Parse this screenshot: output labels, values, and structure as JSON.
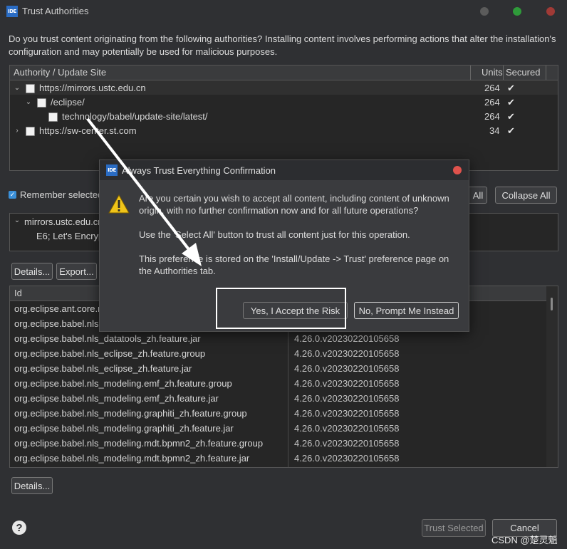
{
  "window": {
    "title": "Trust Authorities",
    "icon_label": "IDE"
  },
  "description": "Do you trust content originating from the following authorities?  Installing content involves performing actions that alter the installation's configuration and may potentially be used for malicious purposes.",
  "authorities_table": {
    "columns": [
      "Authority / Update Site",
      "Units",
      "Secured"
    ],
    "rows": [
      {
        "label": "https://mirrors.ustc.edu.cn",
        "units": "264",
        "indent": 0,
        "chevron": "down"
      },
      {
        "label": "/eclipse/",
        "units": "264",
        "indent": 1,
        "chevron": "down"
      },
      {
        "label": "technology/babel/update-site/latest/",
        "units": "264",
        "indent": 2,
        "chevron": ""
      },
      {
        "label": "https://sw-center.st.com",
        "units": "34",
        "indent": 0,
        "chevron": "right"
      }
    ]
  },
  "remember": {
    "label": "Remember selected"
  },
  "buttons": {
    "select_all_partial": "All",
    "collapse_all": "Collapse All",
    "details": "Details...",
    "export": "Export...",
    "details2": "Details...",
    "trust_selected": "Trust Selected",
    "cancel": "Cancel",
    "help": "?"
  },
  "cert_tree": {
    "item": "mirrors.ustc.edu.cn",
    "child": "E6; Let's Encrypt"
  },
  "units_table": {
    "column_id": "Id",
    "rows": [
      {
        "id": "org.eclipse.ant.core.n",
        "version": ""
      },
      {
        "id": "org.eclipse.babel.nls",
        "version": ""
      },
      {
        "id": "org.eclipse.babel.nls_datatools_zh.feature.jar",
        "version": "4.26.0.v20230220105658"
      },
      {
        "id": "org.eclipse.babel.nls_eclipse_zh.feature.group",
        "version": "4.26.0.v20230220105658"
      },
      {
        "id": "org.eclipse.babel.nls_eclipse_zh.feature.jar",
        "version": "4.26.0.v20230220105658"
      },
      {
        "id": "org.eclipse.babel.nls_modeling.emf_zh.feature.group",
        "version": "4.26.0.v20230220105658"
      },
      {
        "id": "org.eclipse.babel.nls_modeling.emf_zh.feature.jar",
        "version": "4.26.0.v20230220105658"
      },
      {
        "id": "org.eclipse.babel.nls_modeling.graphiti_zh.feature.group",
        "version": "4.26.0.v20230220105658"
      },
      {
        "id": "org.eclipse.babel.nls_modeling.graphiti_zh.feature.jar",
        "version": "4.26.0.v20230220105658"
      },
      {
        "id": "org.eclipse.babel.nls_modeling.mdt.bpmn2_zh.feature.group",
        "version": "4.26.0.v20230220105658"
      },
      {
        "id": "org.eclipse.babel.nls_modeling.mdt.bpmn2_zh.feature.jar",
        "version": "4.26.0.v20230220105658"
      }
    ]
  },
  "dialog": {
    "title": "Always Trust Everything Confirmation",
    "icon_label": "IDE",
    "message1": "Are you certain you wish to accept all content, including content of unknown origin, with no further confirmation now and for all future operations?",
    "message2": "Use the 'Select All' button to trust all content just for this operation.",
    "message3": "This preference is stored on the 'Install/Update -> Trust' preference page on the Authorities tab.",
    "accept_button": "Yes, I Accept the Risk",
    "prompt_button": "No, Prompt Me Instead"
  },
  "watermark": "CSDN @楚灵魈",
  "colors": {
    "close": "#e0524c",
    "min": "#4a4a4a",
    "max": "#3aa34a",
    "accent": "#3a8fd8",
    "highlight": "#ffffff"
  }
}
